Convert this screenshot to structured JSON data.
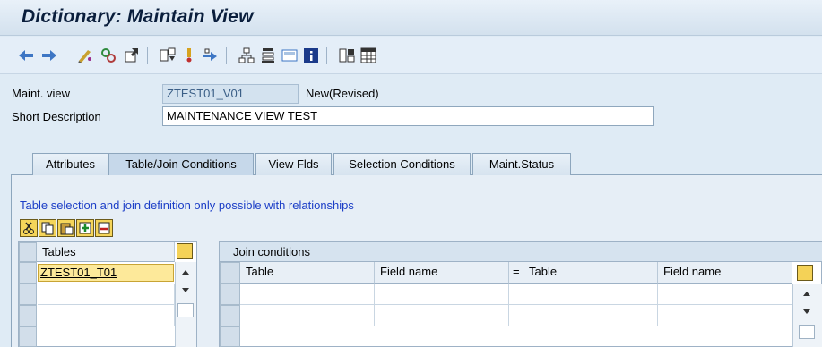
{
  "window": {
    "title": "Dictionary: Maintain View"
  },
  "toolbar": {
    "icons": [
      "back-arrow-icon",
      "forward-arrow-icon",
      "display-change-icon",
      "activate-icon",
      "other-object-icon",
      "where-used-icon",
      "technical-settings-icon",
      "navigate-icon",
      "hierarchy-icon",
      "object-list-icon",
      "screen-icon",
      "info-icon",
      "table-structure-icon",
      "grid-icon"
    ]
  },
  "header": {
    "maint_view_label": "Maint. view",
    "maint_view_value": "ZTEST01_V01",
    "status": "New(Revised)",
    "short_desc_label": "Short Description",
    "short_desc_value": "MAINTENANCE VIEW TEST"
  },
  "tabs": [
    {
      "label": "Attributes"
    },
    {
      "label": "Table/Join Conditions"
    },
    {
      "label": "View Flds"
    },
    {
      "label": "Selection Conditions"
    },
    {
      "label": "Maint.Status"
    }
  ],
  "active_tab": "Table/Join Conditions",
  "content": {
    "info_text": "Table selection and join definition only possible with relationships",
    "mini_toolbar": [
      "cut-icon",
      "copy-icon",
      "paste-icon",
      "insert-row-icon",
      "delete-row-icon"
    ],
    "tables_grid": {
      "header": "Tables",
      "rows": [
        "ZTEST01_T01",
        "",
        ""
      ]
    },
    "join_grid": {
      "title": "Join conditions",
      "columns": [
        "Table",
        "Field name",
        "=",
        "Table",
        "Field name"
      ]
    }
  }
}
